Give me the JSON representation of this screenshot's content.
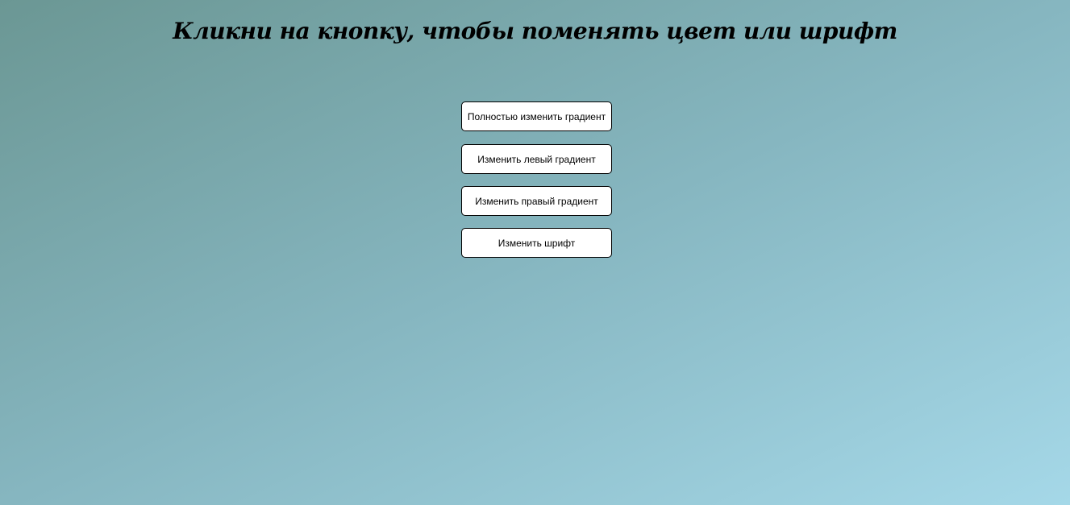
{
  "heading": "Кликни на кнопку, чтобы поменять цвет или шрифт",
  "buttons": {
    "full_gradient": "Полностью изменить градиент",
    "left_gradient": "Изменить левый градиент",
    "right_gradient": "Изменить правый градиент",
    "font": "Изменить шрифт"
  },
  "colors": {
    "gradient_start": "#6b9794",
    "gradient_end": "#a5d8e8"
  }
}
